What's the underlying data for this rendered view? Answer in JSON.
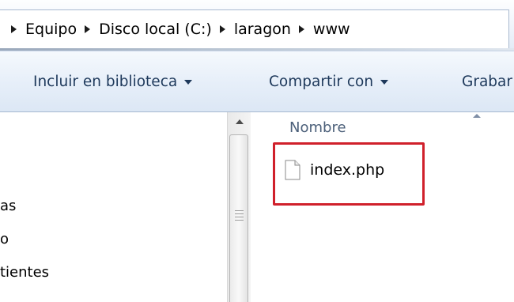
{
  "breadcrumb": [
    "Equipo",
    "Disco local (C:)",
    "laragon",
    "www"
  ],
  "toolbar": {
    "include_library": "Incluir en biblioteca",
    "share_with": "Compartir con",
    "burn": "Grabar"
  },
  "nav_items": [
    "as",
    "o",
    "tientes"
  ],
  "list": {
    "column_name": "Nombre",
    "files": [
      {
        "name": "index.php",
        "icon": "document-icon"
      }
    ]
  },
  "colors": {
    "highlight": "#d0202b"
  }
}
